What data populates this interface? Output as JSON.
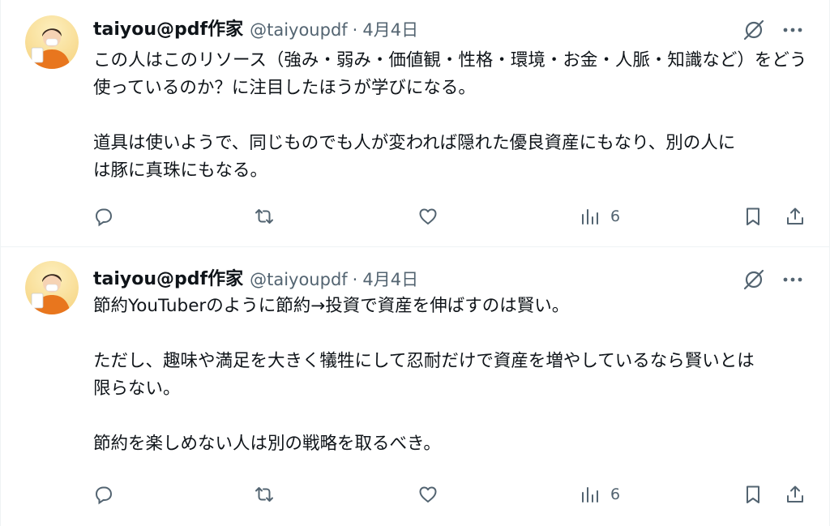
{
  "tweets": [
    {
      "author": {
        "display_name": "taiyou@pdf作家",
        "handle": "@taiyoupdf"
      },
      "dot": "·",
      "date": "4月4日",
      "text": "この人はこのリソース（強み・弱み・価値観・性格・環境・お金・人脈・知識など）をどう\n使っているのか？に注目したほうが学びになる。\n\n道具は使いようで、同じものでも人が変われば隠れた優良資産にもなり、別の人に\nは豚に真珠にもなる。",
      "metrics": {
        "views": "6"
      }
    },
    {
      "author": {
        "display_name": "taiyou@pdf作家",
        "handle": "@taiyoupdf"
      },
      "dot": "·",
      "date": "4月4日",
      "text": "節約YouTuberのように節約→投資で資産を伸ばすのは賢い。\n\nただし、趣味や満足を大きく犠牲にして忍耐だけで資産を増やしているなら賢いとは\n限らない。\n\n節約を楽しめない人は別の戦略を取るべき。",
      "metrics": {
        "views": "6"
      }
    }
  ],
  "icons": {
    "reply": "reply-icon",
    "retweet": "retweet-icon",
    "like": "heart-icon",
    "views": "views-icon",
    "bookmark": "bookmark-icon",
    "share": "share-icon",
    "grok": "grok-icon",
    "more": "more-icon"
  },
  "colors": {
    "text": "#0f1419",
    "secondary": "#536471",
    "border": "#eff3f4",
    "avatar_bg": "#fbe7a6",
    "avatar_shirt": "#e8761e"
  }
}
